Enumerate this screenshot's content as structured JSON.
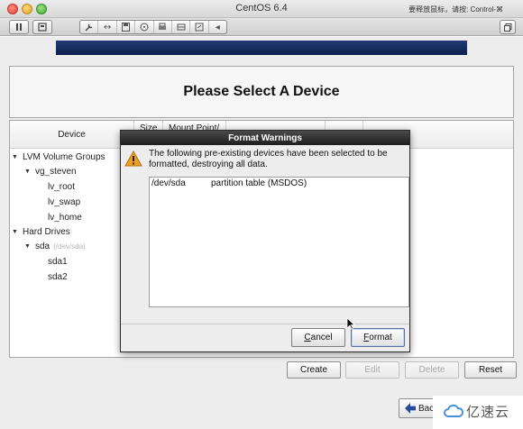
{
  "window": {
    "title": "CentOS 6.4",
    "hint": "要释放鼠标，请按: Control-⌘"
  },
  "toolbar": {
    "icons": [
      "pause-icon",
      "snapshot-icon",
      "settings-icon",
      "network-icon",
      "floppy-icon",
      "cdrom-icon",
      "printer-icon",
      "disk-icon",
      "usb-icon",
      "arrow-left-icon",
      "window-icon"
    ]
  },
  "installer": {
    "page_title": "Please Select A Device",
    "columns": {
      "device": "Device",
      "size": "Size",
      "mount": "Mount Point/"
    },
    "tree": [
      {
        "label": "LVM Volume Groups",
        "sub": ""
      },
      {
        "label": "vg_steven",
        "sub": ""
      },
      {
        "label": "lv_root",
        "sub": ""
      },
      {
        "label": "lv_swap",
        "sub": ""
      },
      {
        "label": "lv_home",
        "sub": ""
      },
      {
        "label": "Hard Drives",
        "sub": ""
      },
      {
        "label": "sda",
        "sub": "(/dev/sda)"
      },
      {
        "label": "sda1",
        "sub": ""
      },
      {
        "label": "sda2",
        "sub": ""
      }
    ],
    "buttons": {
      "create": "Create",
      "edit": "Edit",
      "delete": "Delete",
      "reset": "Reset",
      "back": "Back"
    }
  },
  "dialog": {
    "title": "Format Warnings",
    "message": "The following pre-existing devices have been selected to be formatted, destroying all data.",
    "devices": [
      {
        "name": "/dev/sda",
        "desc": "partition table (MSDOS)"
      }
    ],
    "cancel_label": "Cancel",
    "format_label": "Format"
  },
  "watermark": {
    "text": "亿速云"
  },
  "colors": {
    "progress": "#1a2f63",
    "dialog_title": "#2e2e2e",
    "warning": "#f0a020"
  }
}
